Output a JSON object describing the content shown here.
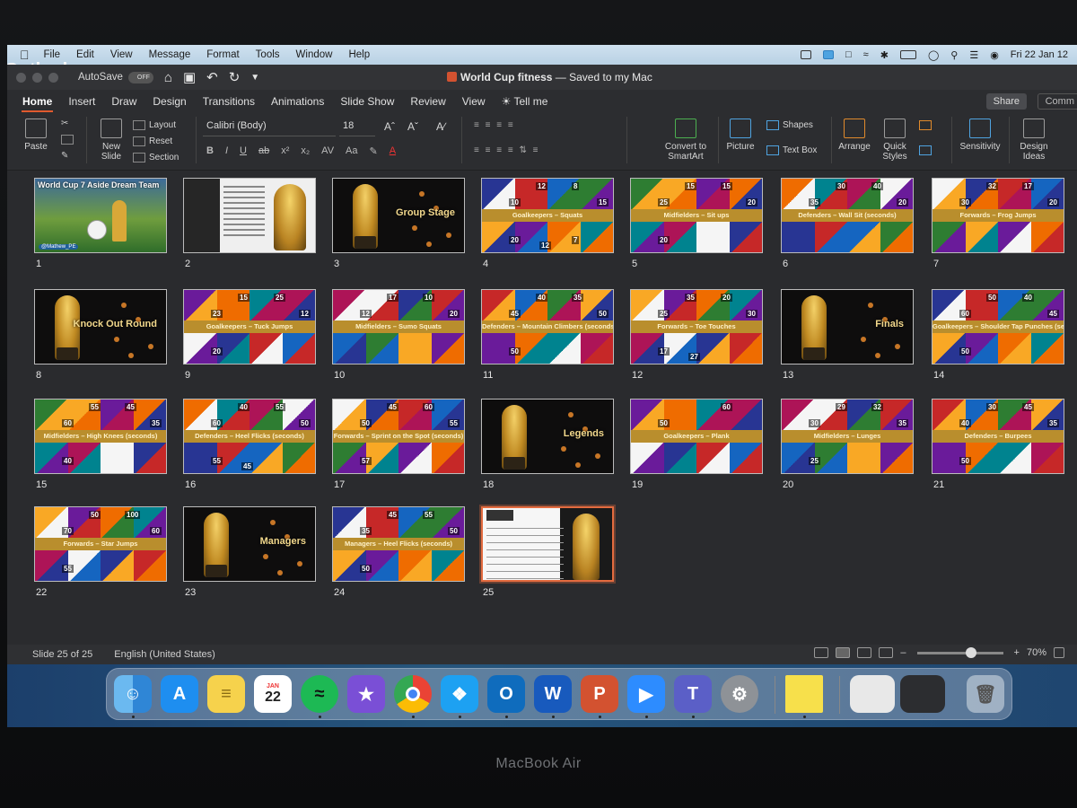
{
  "menubar": {
    "app": "Outlook",
    "items": [
      "File",
      "Edit",
      "View",
      "Message",
      "Format",
      "Tools",
      "Window",
      "Help"
    ],
    "clock": "Fri 22 Jan 12"
  },
  "window": {
    "autosave_label": "AutoSave",
    "autosave_state": "OFF",
    "title": "World Cup fitness",
    "title_suffix": " — Saved to my Mac"
  },
  "tabs": [
    "Home",
    "Insert",
    "Draw",
    "Design",
    "Transitions",
    "Animations",
    "Slide Show",
    "Review",
    "View",
    "Tell me"
  ],
  "share_label": "Share",
  "comments_label": "Comm",
  "ribbon": {
    "paste": "Paste",
    "new_slide": "New Slide",
    "layout": "Layout",
    "reset": "Reset",
    "section": "Section",
    "font": "Calibri (Body)",
    "size": "18",
    "convert": "Convert to SmartArt",
    "picture": "Picture",
    "shapes": "Shapes",
    "text_box": "Text Box",
    "arrange": "Arrange",
    "quick_styles": "Quick Styles",
    "sensitivity": "Sensitivity",
    "design_ideas": "Design Ideas"
  },
  "slides": [
    {
      "n": "1",
      "kind": "cover",
      "title": "World Cup 7 Aside Dream Team",
      "handle": "@Mathew_PE"
    },
    {
      "n": "2",
      "kind": "doc"
    },
    {
      "n": "3",
      "kind": "title",
      "title": "Group Stage"
    },
    {
      "n": "4",
      "kind": "grid",
      "band": "Goalkeepers – Squats",
      "nums": [
        "10",
        "8",
        "15",
        "12",
        "20",
        "12",
        "7"
      ]
    },
    {
      "n": "5",
      "kind": "grid",
      "band": "Midfielders – Sit ups",
      "nums": [
        "25",
        "15",
        "20",
        "15",
        "20"
      ]
    },
    {
      "n": "6",
      "kind": "grid",
      "band": "Defenders – Wall Sit (seconds)",
      "nums": [
        "35",
        "40",
        "20",
        "30"
      ]
    },
    {
      "n": "7",
      "kind": "grid",
      "band": "Forwards – Frog Jumps",
      "nums": [
        "30",
        "17",
        "20",
        "32"
      ]
    },
    {
      "n": "8",
      "kind": "title",
      "title": "Knock Out Round"
    },
    {
      "n": "9",
      "kind": "grid",
      "band": "Goalkeepers – Tuck Jumps",
      "nums": [
        "23",
        "25",
        "12",
        "15",
        "20"
      ]
    },
    {
      "n": "10",
      "kind": "grid",
      "band": "Midfielders – Sumo Squats",
      "nums": [
        "12",
        "10",
        "20",
        "17"
      ]
    },
    {
      "n": "11",
      "kind": "grid",
      "band": "Defenders – Mountain Climbers (seconds)",
      "nums": [
        "45",
        "35",
        "50",
        "40",
        "50"
      ]
    },
    {
      "n": "12",
      "kind": "grid",
      "band": "Forwards – Toe Touches",
      "nums": [
        "25",
        "20",
        "30",
        "35",
        "17",
        "27"
      ]
    },
    {
      "n": "13",
      "kind": "title",
      "title": "Finals"
    },
    {
      "n": "14",
      "kind": "grid",
      "band": "Goalkeepers – Shoulder Tap Punches (seconds)",
      "nums": [
        "60",
        "40",
        "45",
        "50",
        "50"
      ]
    },
    {
      "n": "15",
      "kind": "grid",
      "band": "Midfielders – High Knees (seconds)",
      "nums": [
        "60",
        "45",
        "35",
        "55",
        "40"
      ]
    },
    {
      "n": "16",
      "kind": "grid",
      "band": "Defenders – Heel Flicks (seconds)",
      "nums": [
        "60",
        "55",
        "50",
        "40",
        "55",
        "45"
      ]
    },
    {
      "n": "17",
      "kind": "grid",
      "band": "Forwards – Sprint on the Spot (seconds)",
      "nums": [
        "50",
        "60",
        "55",
        "45",
        "57"
      ]
    },
    {
      "n": "18",
      "kind": "title",
      "title": "Legends"
    },
    {
      "n": "19",
      "kind": "grid",
      "band": "Goalkeepers – Plank",
      "nums": [
        "50",
        "60"
      ]
    },
    {
      "n": "20",
      "kind": "grid",
      "band": "Midfielders – Lunges",
      "nums": [
        "30",
        "32",
        "35",
        "29",
        "25"
      ]
    },
    {
      "n": "21",
      "kind": "grid",
      "band": "Defenders – Burpees",
      "nums": [
        "40",
        "45",
        "35",
        "30",
        "50"
      ]
    },
    {
      "n": "22",
      "kind": "grid",
      "band": "Forwards – Star Jumps",
      "nums": [
        "70",
        "100",
        "60",
        "50",
        "55"
      ]
    },
    {
      "n": "23",
      "kind": "title",
      "title": "Managers"
    },
    {
      "n": "24",
      "kind": "grid",
      "band": "Managers – Heel Flicks (seconds)",
      "nums": [
        "35",
        "55",
        "50",
        "45",
        "50"
      ]
    },
    {
      "n": "25",
      "kind": "table",
      "selected": true
    }
  ],
  "status": {
    "slide_count": "Slide 25 of 25",
    "language": "English (United States)",
    "zoom": "70%"
  },
  "dock": {
    "calendar_month": "JAN",
    "calendar_day": "22",
    "apps": [
      "finder-icon",
      "app-store-icon",
      "notes-icon",
      "calendar-icon",
      "spotify-icon",
      "imovie-icon",
      "chrome-icon",
      "twitter-icon",
      "outlook-icon",
      "word-icon",
      "powerpoint-icon",
      "zoom-icon",
      "teams-icon",
      "system-preferences-icon",
      "stickies-icon",
      "trash-icon"
    ]
  },
  "laptop_label": "MacBook Air"
}
